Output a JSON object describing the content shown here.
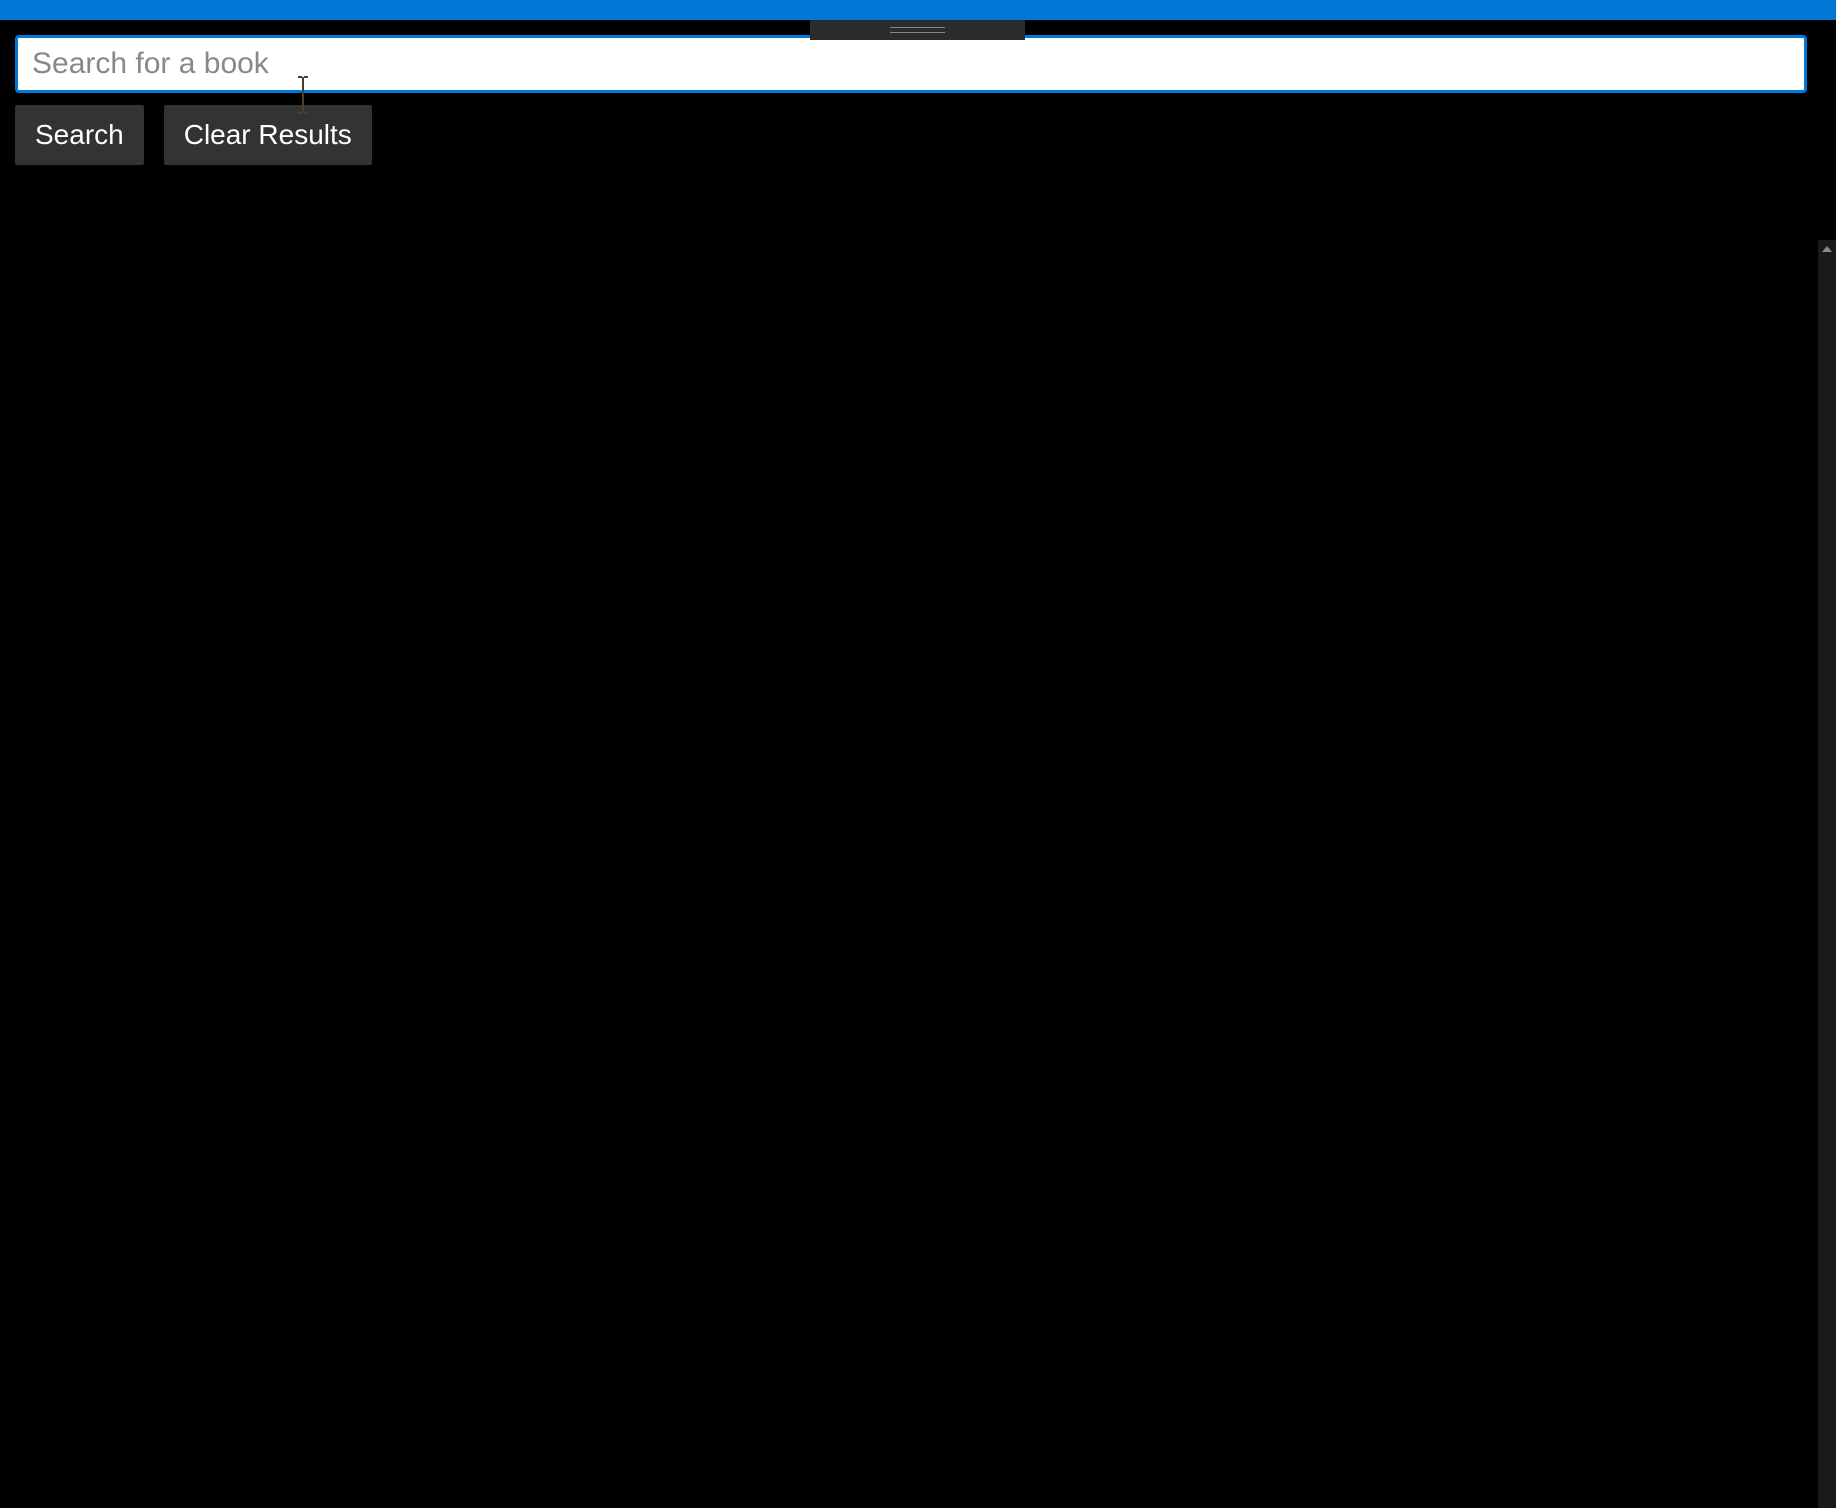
{
  "search": {
    "placeholder": "Search for a book",
    "value": ""
  },
  "buttons": {
    "search_label": "Search",
    "clear_label": "Clear Results"
  }
}
